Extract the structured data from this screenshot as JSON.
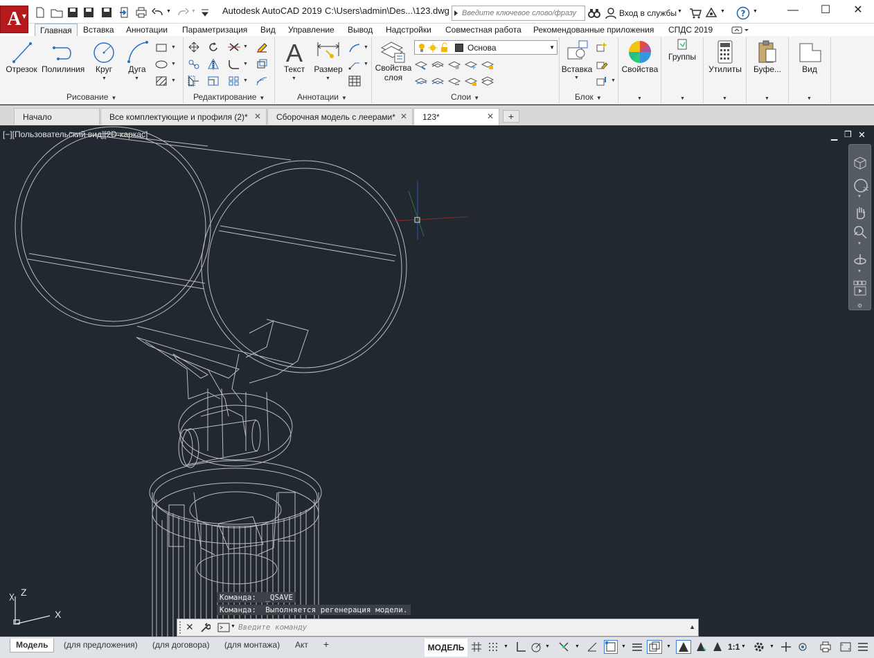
{
  "app": {
    "logo": "A",
    "title": "Autodesk AutoCAD 2019",
    "file": "C:\\Users\\admin\\Des...\\123.dwg"
  },
  "search": {
    "placeholder": "Введите ключевое слово/фразу"
  },
  "account": {
    "signin": "Вход в службы"
  },
  "menu_tabs": [
    "Главная",
    "Вставка",
    "Аннотации",
    "Параметризация",
    "Вид",
    "Управление",
    "Вывод",
    "Надстройки",
    "Совместная работа",
    "Рекомендованные приложения",
    "СПДС 2019"
  ],
  "ribbon": {
    "draw": {
      "label": "Рисование",
      "line": "Отрезок",
      "polyline": "Полилиния",
      "circle": "Круг",
      "arc": "Дуга"
    },
    "modify": {
      "label": "Редактирование"
    },
    "annotation": {
      "label": "Аннотации",
      "text": "Текст",
      "dimension": "Размер"
    },
    "layers": {
      "label": "Слои",
      "props1": "Свойства",
      "props2": "слоя",
      "current": "Основа"
    },
    "block": {
      "label": "Блок",
      "insert": "Вставка"
    },
    "properties": "Свойства",
    "groups": "Группы",
    "utilities": "Утилиты",
    "clipboard": "Буфе...",
    "view": "Вид"
  },
  "doc_tabs": [
    {
      "label": "Начало"
    },
    {
      "label": "Все комплектующие и профиля (2)*"
    },
    {
      "label": "Сборочная модель с леерами*"
    },
    {
      "label": "123*"
    }
  ],
  "viewport": {
    "label": "[−][Пользовательский вид][2D-каркас]",
    "ucs_z": "Z",
    "ucs_x": "X"
  },
  "command": {
    "history": [
      "Команда:  _QSAVE",
      "Команда:  Выполняется регенерация модели."
    ],
    "placeholder": "Введите команду"
  },
  "layout_tabs": [
    "Модель",
    "(для предложения)",
    "(для договора)",
    "(для монтажа)",
    "Акт"
  ],
  "status": {
    "space": "МОДЕЛЬ",
    "scale": "1:1"
  },
  "colors": {
    "accent": "#b4191b",
    "canvas": "#212830"
  }
}
